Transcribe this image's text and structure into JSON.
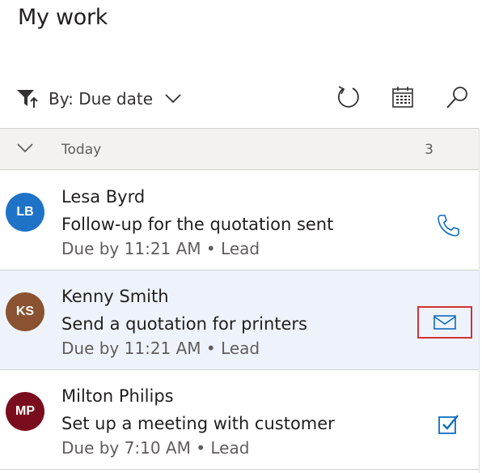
{
  "page": {
    "title": "My work"
  },
  "toolbar": {
    "filter_label": "By: Due date",
    "icons": [
      "filter-sort-icon",
      "chevron-down-icon",
      "refresh-icon",
      "calendar-icon",
      "search-icon"
    ]
  },
  "group": {
    "title": "Today",
    "count": "3"
  },
  "colors": {
    "accent": "#0f6cbd",
    "selected_row": "#eef3fb",
    "highlight_border": "#d13438"
  },
  "items": [
    {
      "initials": "LB",
      "avatar_color": "#1e73c7",
      "name": "Lesa Byrd",
      "subject": "Follow-up for the quotation sent",
      "due": "Due by 11:21 AM • Lead",
      "action_icon": "phone-icon"
    },
    {
      "initials": "KS",
      "avatar_color": "#8a5230",
      "name": "Kenny Smith",
      "subject": "Send a quotation for printers",
      "due": "Due by 11:21 AM • Lead",
      "action_icon": "mail-icon"
    },
    {
      "initials": "MP",
      "avatar_color": "#7a0d1d",
      "name": "Milton Philips",
      "subject": "Set up a meeting with customer",
      "due": "Due by 7:10 AM • Lead",
      "action_icon": "task-check-icon"
    }
  ]
}
